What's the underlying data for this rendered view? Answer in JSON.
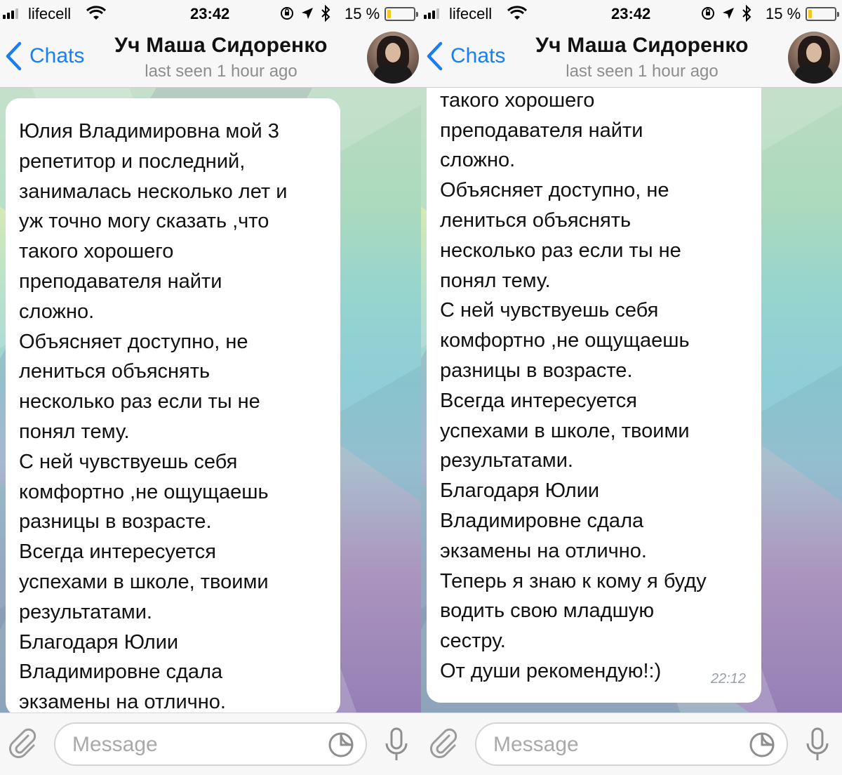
{
  "status_bar": {
    "carrier": "lifecell",
    "time": "23:42",
    "battery_percent": "15 %",
    "battery_level": 0.15,
    "icons": [
      "signal-icon",
      "wifi-icon",
      "orientation-lock-icon",
      "location-icon",
      "bluetooth-icon",
      "battery-icon"
    ]
  },
  "nav": {
    "back_label": "Chats",
    "title": "Уч Маша Сидоренко",
    "subtitle": "last seen 1 hour ago"
  },
  "messages": {
    "left_text": "Юлия Владимировна мой 3\nрепетитор и последний,\nзанималась несколько лет и\nуж точно могу сказать ,что\nтакого хорошего\nпреподавателя найти\nсложно.\nОбъясняет доступно, не\nлениться объяснять\nнесколько раз если ты не\nпонял тему.\nС ней чувствуешь себя\nкомфортно ,не ощущаешь\nразницы в возрасте.\nВсегда интересуется\nуспехами в школе, твоими\nрезультатами.\nБлагодаря Юлии\nВладимировне сдала\nэкзамены на отлично.\nТеперь я знаю к кому я буду",
    "right_text": "уж точно могу сказать ,что\nтакого хорошего\nпреподавателя найти\nсложно.\nОбъясняет доступно, не\nлениться объяснять\nнесколько раз если ты не\nпонял тему.\nС ней чувствуешь себя\nкомфортно ,не ощущаешь\nразницы в возрасте.\nВсегда интересуется\nуспехами в школе, твоими\nрезультатами.\nБлагодаря Юлии\nВладимировне сдала\nэкзамены на отлично.\nТеперь я знаю к кому я буду\nводить свою младшую\nсестру.\nОт души рекомендую!:)",
    "time": "22:12"
  },
  "input": {
    "placeholder": "Message"
  }
}
